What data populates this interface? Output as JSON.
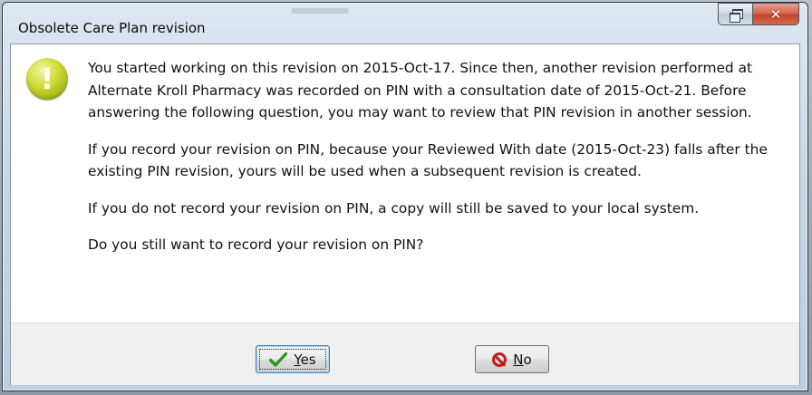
{
  "window": {
    "title": "Obsolete Care Plan revision",
    "restore_icon": "restore-icon",
    "close_icon": "close-icon"
  },
  "message": {
    "icon": "warning-exclamation-icon",
    "paragraphs": [
      "You started working on this revision on 2015-Oct-17.  Since then, another revision performed at Alternate Kroll Pharmacy was recorded on PIN with a consultation date of 2015-Oct-21.  Before answering the following question, you may want to review that PIN revision in another session.",
      "If you record your revision on PIN, because your Reviewed With date (2015-Oct-23) falls after the existing PIN revision, yours will be used when a subsequent revision is created.",
      "If you do not record your revision on PIN, a copy will still be saved to your local system.",
      "Do you still want to record your revision on PIN?"
    ]
  },
  "buttons": {
    "yes": {
      "mnemonic": "Y",
      "rest": "es",
      "icon": "checkmark-icon"
    },
    "no": {
      "mnemonic": "N",
      "rest": "o",
      "icon": "no-entry-icon"
    }
  },
  "colors": {
    "icon_yellow": "#cfdc38",
    "check_green": "#2a9a19",
    "no_red": "#c41b1b",
    "close_red": "#c0432c"
  }
}
